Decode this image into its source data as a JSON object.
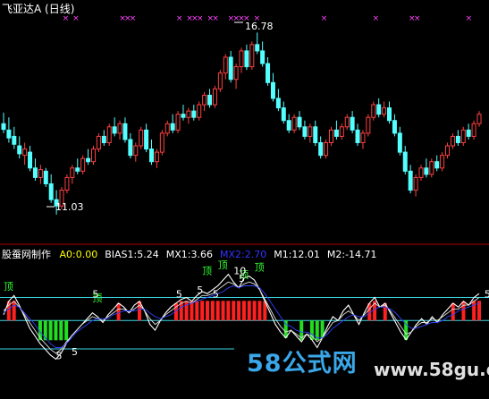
{
  "upper": {
    "title": "飞亚达A",
    "period": "(日线)",
    "high_marker": "16.78",
    "low_marker": "11.03",
    "cross_color": "#ff44ff",
    "up_color": "#ff4040",
    "down_color": "#54ffff"
  },
  "indicator": {
    "name": "股蚕网制作",
    "items": [
      {
        "label": "A0:0.00",
        "color": "#ffff00"
      },
      {
        "label": "BIAS1:5.24",
        "color": "#ffffff"
      },
      {
        "label": "MX1:3.66",
        "color": "#ffffff"
      },
      {
        "label": "MX2:2.70",
        "color": "#3333ff"
      },
      {
        "label": "M1:12.01",
        "color": "#ffffff"
      },
      {
        "label": "M2:-14.71",
        "color": "#ffffff"
      }
    ],
    "annotations": [
      "顶",
      "顶",
      "顶",
      "顶",
      "顶",
      "顶",
      "5",
      "5",
      "5",
      "5",
      "5",
      "5",
      "5",
      "10",
      "5"
    ]
  },
  "watermark": {
    "brand": "58公式网",
    "url": "www.58gu.com"
  },
  "chart_data": {
    "type": "candlestick",
    "title": "飞亚达A (日线)",
    "annotations": [
      "16.78",
      "11.03"
    ],
    "candles": [
      {
        "o": 13.9,
        "h": 14.25,
        "l": 13.6,
        "c": 13.72
      },
      {
        "o": 13.7,
        "h": 14.1,
        "l": 13.3,
        "c": 13.45
      },
      {
        "o": 13.5,
        "h": 13.8,
        "l": 13.1,
        "c": 13.25
      },
      {
        "o": 13.2,
        "h": 13.5,
        "l": 12.8,
        "c": 12.95
      },
      {
        "o": 12.9,
        "h": 13.3,
        "l": 12.6,
        "c": 13.1
      },
      {
        "o": 13.0,
        "h": 13.2,
        "l": 12.4,
        "c": 12.5
      },
      {
        "o": 12.5,
        "h": 12.8,
        "l": 12.1,
        "c": 12.2
      },
      {
        "o": 12.2,
        "h": 12.6,
        "l": 12.0,
        "c": 12.45
      },
      {
        "o": 12.4,
        "h": 12.5,
        "l": 11.9,
        "c": 12.0
      },
      {
        "o": 12.0,
        "h": 12.3,
        "l": 11.4,
        "c": 11.5
      },
      {
        "o": 11.5,
        "h": 11.8,
        "l": 11.03,
        "c": 11.3
      },
      {
        "o": 11.3,
        "h": 11.9,
        "l": 11.2,
        "c": 11.8
      },
      {
        "o": 11.8,
        "h": 12.3,
        "l": 11.7,
        "c": 12.2
      },
      {
        "o": 12.2,
        "h": 12.6,
        "l": 12.0,
        "c": 12.5
      },
      {
        "o": 12.5,
        "h": 12.8,
        "l": 12.3,
        "c": 12.4
      },
      {
        "o": 12.4,
        "h": 12.9,
        "l": 12.3,
        "c": 12.8
      },
      {
        "o": 12.8,
        "h": 13.1,
        "l": 12.6,
        "c": 12.7
      },
      {
        "o": 12.7,
        "h": 13.2,
        "l": 12.6,
        "c": 13.1
      },
      {
        "o": 13.1,
        "h": 13.6,
        "l": 13.0,
        "c": 13.5
      },
      {
        "o": 13.5,
        "h": 13.7,
        "l": 13.2,
        "c": 13.3
      },
      {
        "o": 13.3,
        "h": 13.9,
        "l": 13.2,
        "c": 13.8
      },
      {
        "o": 13.8,
        "h": 14.1,
        "l": 13.5,
        "c": 13.6
      },
      {
        "o": 13.6,
        "h": 14.0,
        "l": 13.4,
        "c": 13.9
      },
      {
        "o": 13.9,
        "h": 14.1,
        "l": 13.3,
        "c": 13.4
      },
      {
        "o": 13.4,
        "h": 13.6,
        "l": 12.8,
        "c": 12.9
      },
      {
        "o": 12.9,
        "h": 13.3,
        "l": 12.7,
        "c": 13.2
      },
      {
        "o": 13.2,
        "h": 13.8,
        "l": 13.1,
        "c": 13.7
      },
      {
        "o": 13.7,
        "h": 13.9,
        "l": 13.0,
        "c": 13.1
      },
      {
        "o": 13.1,
        "h": 13.4,
        "l": 12.6,
        "c": 12.7
      },
      {
        "o": 12.7,
        "h": 13.1,
        "l": 12.5,
        "c": 13.0
      },
      {
        "o": 13.0,
        "h": 13.7,
        "l": 12.9,
        "c": 13.6
      },
      {
        "o": 13.6,
        "h": 14.0,
        "l": 13.5,
        "c": 13.9
      },
      {
        "o": 13.9,
        "h": 14.2,
        "l": 13.6,
        "c": 13.7
      },
      {
        "o": 13.7,
        "h": 14.3,
        "l": 13.6,
        "c": 14.2
      },
      {
        "o": 14.2,
        "h": 14.5,
        "l": 14.0,
        "c": 14.1
      },
      {
        "o": 14.1,
        "h": 14.4,
        "l": 13.9,
        "c": 14.3
      },
      {
        "o": 14.3,
        "h": 14.5,
        "l": 14.0,
        "c": 14.1
      },
      {
        "o": 14.1,
        "h": 14.6,
        "l": 14.0,
        "c": 14.5
      },
      {
        "o": 14.5,
        "h": 14.9,
        "l": 14.3,
        "c": 14.8
      },
      {
        "o": 14.8,
        "h": 15.0,
        "l": 14.4,
        "c": 14.5
      },
      {
        "o": 14.5,
        "h": 15.1,
        "l": 14.4,
        "c": 15.0
      },
      {
        "o": 15.0,
        "h": 15.6,
        "l": 14.9,
        "c": 15.5
      },
      {
        "o": 15.5,
        "h": 16.1,
        "l": 15.3,
        "c": 16.0
      },
      {
        "o": 16.0,
        "h": 16.2,
        "l": 15.2,
        "c": 15.3
      },
      {
        "o": 15.3,
        "h": 15.8,
        "l": 15.0,
        "c": 15.7
      },
      {
        "o": 15.7,
        "h": 16.3,
        "l": 15.5,
        "c": 16.2
      },
      {
        "o": 16.2,
        "h": 16.4,
        "l": 15.6,
        "c": 15.7
      },
      {
        "o": 15.7,
        "h": 16.5,
        "l": 15.6,
        "c": 16.4
      },
      {
        "o": 16.4,
        "h": 16.78,
        "l": 16.1,
        "c": 16.2
      },
      {
        "o": 16.2,
        "h": 16.5,
        "l": 15.7,
        "c": 15.8
      },
      {
        "o": 15.8,
        "h": 16.0,
        "l": 15.1,
        "c": 15.2
      },
      {
        "o": 15.2,
        "h": 15.5,
        "l": 14.6,
        "c": 14.7
      },
      {
        "o": 14.7,
        "h": 15.0,
        "l": 14.3,
        "c": 14.4
      },
      {
        "o": 14.4,
        "h": 14.6,
        "l": 13.9,
        "c": 14.0
      },
      {
        "o": 14.0,
        "h": 14.2,
        "l": 13.6,
        "c": 13.7
      },
      {
        "o": 13.7,
        "h": 14.2,
        "l": 13.6,
        "c": 14.1
      },
      {
        "o": 14.1,
        "h": 14.3,
        "l": 13.7,
        "c": 13.8
      },
      {
        "o": 13.8,
        "h": 14.0,
        "l": 13.4,
        "c": 13.5
      },
      {
        "o": 13.5,
        "h": 13.9,
        "l": 13.3,
        "c": 13.8
      },
      {
        "o": 13.8,
        "h": 14.0,
        "l": 13.2,
        "c": 13.3
      },
      {
        "o": 13.3,
        "h": 13.5,
        "l": 12.8,
        "c": 12.9
      },
      {
        "o": 12.9,
        "h": 13.4,
        "l": 12.8,
        "c": 13.3
      },
      {
        "o": 13.3,
        "h": 13.8,
        "l": 13.2,
        "c": 13.7
      },
      {
        "o": 13.7,
        "h": 14.0,
        "l": 13.4,
        "c": 13.5
      },
      {
        "o": 13.5,
        "h": 13.9,
        "l": 13.4,
        "c": 13.8
      },
      {
        "o": 13.8,
        "h": 14.2,
        "l": 13.7,
        "c": 14.1
      },
      {
        "o": 14.1,
        "h": 14.3,
        "l": 13.6,
        "c": 13.7
      },
      {
        "o": 13.7,
        "h": 13.9,
        "l": 13.2,
        "c": 13.3
      },
      {
        "o": 13.3,
        "h": 13.7,
        "l": 13.1,
        "c": 13.6
      },
      {
        "o": 13.6,
        "h": 14.2,
        "l": 13.5,
        "c": 14.1
      },
      {
        "o": 14.1,
        "h": 14.6,
        "l": 14.0,
        "c": 14.5
      },
      {
        "o": 14.5,
        "h": 14.7,
        "l": 14.1,
        "c": 14.2
      },
      {
        "o": 14.2,
        "h": 14.6,
        "l": 14.1,
        "c": 14.4
      },
      {
        "o": 14.4,
        "h": 14.6,
        "l": 13.9,
        "c": 14.0
      },
      {
        "o": 14.0,
        "h": 14.2,
        "l": 13.5,
        "c": 13.6
      },
      {
        "o": 13.6,
        "h": 13.8,
        "l": 12.9,
        "c": 13.0
      },
      {
        "o": 13.0,
        "h": 13.2,
        "l": 12.3,
        "c": 12.4
      },
      {
        "o": 12.4,
        "h": 12.6,
        "l": 11.7,
        "c": 11.8
      },
      {
        "o": 11.8,
        "h": 12.3,
        "l": 11.6,
        "c": 12.2
      },
      {
        "o": 12.2,
        "h": 12.6,
        "l": 12.1,
        "c": 12.5
      },
      {
        "o": 12.5,
        "h": 12.8,
        "l": 12.2,
        "c": 12.3
      },
      {
        "o": 12.3,
        "h": 12.8,
        "l": 12.2,
        "c": 12.7
      },
      {
        "o": 12.7,
        "h": 12.9,
        "l": 12.4,
        "c": 12.5
      },
      {
        "o": 12.5,
        "h": 13.0,
        "l": 12.4,
        "c": 12.9
      },
      {
        "o": 12.9,
        "h": 13.3,
        "l": 12.8,
        "c": 13.2
      },
      {
        "o": 13.2,
        "h": 13.6,
        "l": 13.1,
        "c": 13.5
      },
      {
        "o": 13.5,
        "h": 13.7,
        "l": 13.2,
        "c": 13.3
      },
      {
        "o": 13.3,
        "h": 13.8,
        "l": 13.2,
        "c": 13.7
      },
      {
        "o": 13.7,
        "h": 13.9,
        "l": 13.4,
        "c": 13.5
      },
      {
        "o": 13.5,
        "h": 14.0,
        "l": 13.4,
        "c": 13.9
      },
      {
        "o": 13.9,
        "h": 14.3,
        "l": 13.8,
        "c": 14.2
      }
    ],
    "oscillator": {
      "series": [
        {
          "name": "BIAS1",
          "values": [
            3,
            10,
            13,
            8,
            2,
            -4,
            -8,
            -12,
            -15,
            -18,
            -20,
            -17,
            -12,
            -8,
            -5,
            -2,
            1,
            4,
            2,
            -1,
            3,
            6,
            9,
            7,
            4,
            8,
            10,
            5,
            -2,
            -5,
            0,
            4,
            7,
            9,
            11,
            12,
            10,
            13,
            15,
            14,
            16,
            18,
            21,
            24,
            20,
            17,
            22,
            23,
            21,
            16,
            10,
            4,
            -2,
            -6,
            -9,
            -5,
            -8,
            -11,
            -7,
            -10,
            -14,
            -9,
            -3,
            2,
            0,
            5,
            8,
            3,
            -2,
            4,
            9,
            12,
            7,
            9,
            4,
            -1,
            -6,
            -10,
            -6,
            -2,
            1,
            -2,
            2,
            -1,
            3,
            6,
            9,
            7,
            10,
            8,
            12,
            14
          ]
        },
        {
          "name": "MX1",
          "values": [
            5,
            8,
            10,
            7,
            3,
            -1,
            -5,
            -9,
            -12,
            -15,
            -17,
            -15,
            -11,
            -8,
            -5,
            -2,
            0,
            2,
            1,
            0,
            2,
            4,
            6,
            6,
            4,
            6,
            8,
            5,
            1,
            -2,
            0,
            3,
            5,
            7,
            9,
            10,
            9,
            11,
            13,
            13,
            14,
            16,
            18,
            20,
            19,
            17,
            19,
            20,
            19,
            16,
            11,
            6,
            1,
            -3,
            -6,
            -5,
            -7,
            -9,
            -7,
            -8,
            -11,
            -9,
            -5,
            -1,
            0,
            3,
            5,
            3,
            0,
            3,
            6,
            9,
            7,
            8,
            5,
            1,
            -3,
            -7,
            -6,
            -3,
            -1,
            -1,
            1,
            0,
            2,
            4,
            6,
            6,
            8,
            8,
            10,
            12
          ]
        },
        {
          "name": "MX2",
          "values": [
            4,
            6,
            8,
            7,
            4,
            1,
            -2,
            -6,
            -9,
            -12,
            -14,
            -14,
            -12,
            -9,
            -6,
            -4,
            -2,
            0,
            1,
            1,
            1,
            3,
            4,
            5,
            5,
            5,
            6,
            6,
            4,
            2,
            1,
            2,
            3,
            5,
            7,
            8,
            9,
            10,
            11,
            12,
            13,
            14,
            15,
            17,
            18,
            17,
            18,
            18,
            18,
            17,
            14,
            10,
            6,
            2,
            -2,
            -3,
            -5,
            -6,
            -6,
            -7,
            -9,
            -9,
            -7,
            -4,
            -2,
            0,
            2,
            3,
            2,
            2,
            4,
            6,
            7,
            7,
            6,
            4,
            1,
            -2,
            -4,
            -4,
            -3,
            -2,
            -1,
            -1,
            0,
            2,
            3,
            5,
            6,
            7,
            8,
            9
          ]
        }
      ],
      "reference_lines": {
        "M1": 12.01,
        "M2": -14.71,
        "A0": 0.0
      },
      "ylim": [
        -24,
        28
      ]
    }
  }
}
